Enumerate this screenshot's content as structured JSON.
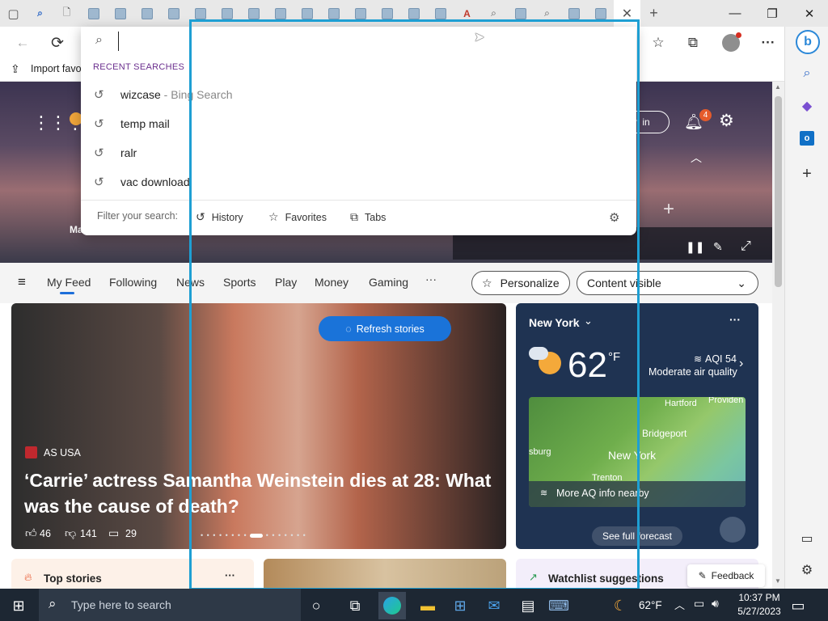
{
  "toolbar": {
    "back": "←",
    "refresh": "⟳"
  },
  "favorites": {
    "import_label": "Import favo"
  },
  "search": {
    "value": "",
    "recent_header": "RECENT SEARCHES",
    "items": [
      {
        "text": "wizcase",
        "suffix": " - Bing Search"
      },
      {
        "text": "temp mail",
        "suffix": ""
      },
      {
        "text": "ralr",
        "suffix": ""
      },
      {
        "text": "vac download",
        "suffix": ""
      }
    ],
    "filter_label": "Filter your search:",
    "filters": [
      "History",
      "Favorites",
      "Tabs"
    ]
  },
  "hero": {
    "sign_in": "n in",
    "notif_count": "4",
    "partial_left": "Ma"
  },
  "feed_nav": {
    "items": [
      "My Feed",
      "Following",
      "News",
      "Sports",
      "Play",
      "Money",
      "Gaming",
      "···"
    ],
    "personalize": "Personalize",
    "content_visible": "Content visible"
  },
  "main_story": {
    "source": "AS USA",
    "headline": "‘Carrie’ actress Samantha Weinstein dies at 28: What was the cause of death?",
    "likes": "46",
    "dislikes": "141",
    "comments": "29",
    "refresh": "Refresh stories"
  },
  "weather": {
    "city": "New York",
    "temp": "62",
    "unit": "°F",
    "aqi": "AQI 54",
    "aqi_desc": "Moderate air quality",
    "map_labels": [
      "Hartford",
      "Providen",
      "Bridgeport",
      "New York",
      "sburg",
      "Trenton"
    ],
    "more_aq": "More AQ info nearby",
    "forecast": "See full forecast"
  },
  "bottom": {
    "top_stories": "Top stories",
    "watchlist": "Watchlist suggestions",
    "feedback": "Feedback"
  },
  "taskbar": {
    "search_placeholder": "Type here to search",
    "weather": "62°F",
    "time": "10:37 PM",
    "date": "5/27/2023"
  },
  "colors": {
    "accent": "#1e9fd3",
    "refresh_btn": "#1a73d9",
    "weather_bg": "#1f3352",
    "taskbar": "#1d2733"
  }
}
